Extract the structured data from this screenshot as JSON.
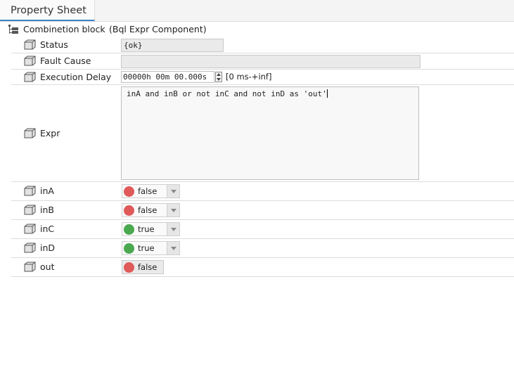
{
  "tab": {
    "title": "Property Sheet"
  },
  "header": {
    "component_name": "Combinetion block",
    "component_type": "(Bql Expr Component)"
  },
  "properties": {
    "status": {
      "label": "Status",
      "value": "{ok}"
    },
    "fault_cause": {
      "label": "Fault Cause",
      "value": ""
    },
    "execution_delay": {
      "label": "Execution Delay",
      "value": "00000h 00m 00.000s",
      "range": "[0 ms-+inf]"
    },
    "expr": {
      "label": "Expr",
      "value": "inA and inB or not inC and not inD as 'out'"
    },
    "inA": {
      "label": "inA",
      "value": "false",
      "status_color": "#e05a5a"
    },
    "inB": {
      "label": "inB",
      "value": "false",
      "status_color": "#e05a5a"
    },
    "inC": {
      "label": "inC",
      "value": "true",
      "status_color": "#4aa84f"
    },
    "inD": {
      "label": "inD",
      "value": "true",
      "status_color": "#4aa84f"
    },
    "out": {
      "label": "out",
      "value": "false",
      "status_color": "#e05a5a"
    }
  },
  "icons": {
    "tree": "tree-icon",
    "property": "cube-icon",
    "spinner": "spinner-icon",
    "dropdown": "chevron-down-icon"
  }
}
